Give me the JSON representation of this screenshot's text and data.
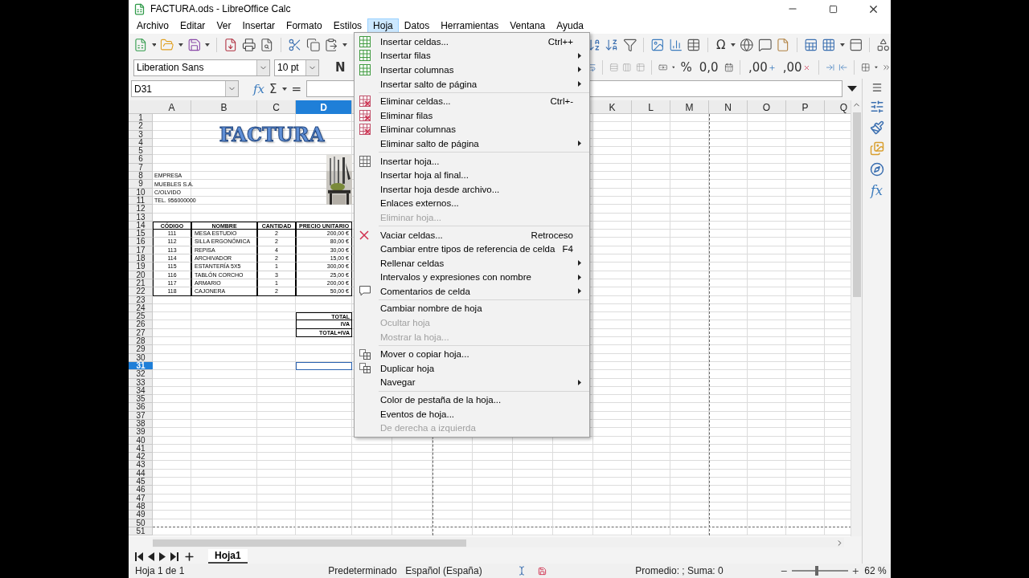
{
  "window": {
    "title": "FACTURA.ods - LibreOffice Calc"
  },
  "menubar": [
    {
      "label": "Archivo",
      "selected": false
    },
    {
      "label": "Editar",
      "selected": false
    },
    {
      "label": "Ver",
      "selected": false
    },
    {
      "label": "Insertar",
      "selected": false
    },
    {
      "label": "Formato",
      "selected": false
    },
    {
      "label": "Estilos",
      "selected": false
    },
    {
      "label": "Hoja",
      "selected": true
    },
    {
      "label": "Datos",
      "selected": false
    },
    {
      "label": "Herramientas",
      "selected": false
    },
    {
      "label": "Ventana",
      "selected": false
    },
    {
      "label": "Ayuda",
      "selected": false
    }
  ],
  "toolbar": {
    "special_character": "Ω",
    "percent": "%",
    "number_format": "0,0",
    "add_decimal": ",00",
    "delete_decimal": ",00",
    "bold": "N"
  },
  "font_name": "Liberation Sans",
  "font_size": "10 pt",
  "name_box": "D31",
  "formula_bar": {
    "function_wizard": "fx",
    "sum": "Σ",
    "equals": "="
  },
  "sheet": {
    "columns": [
      {
        "label": "A",
        "selected": false
      },
      {
        "label": "B",
        "selected": false
      },
      {
        "label": "C",
        "selected": false
      },
      {
        "label": "D",
        "selected": true
      },
      {
        "label": "K",
        "selected": false
      },
      {
        "label": "L",
        "selected": false
      },
      {
        "label": "M",
        "selected": false
      },
      {
        "label": "N",
        "selected": false
      },
      {
        "label": "O",
        "selected": false
      },
      {
        "label": "P",
        "selected": false
      },
      {
        "label": "Q",
        "selected": false
      }
    ],
    "rows": [
      {
        "label": "1",
        "selected": false
      },
      {
        "label": "2",
        "selected": false
      },
      {
        "label": "3",
        "selected": false
      },
      {
        "label": "4",
        "selected": false
      },
      {
        "label": "5",
        "selected": false
      },
      {
        "label": "6",
        "selected": false
      },
      {
        "label": "7",
        "selected": false
      },
      {
        "label": "8",
        "selected": false
      },
      {
        "label": "9",
        "selected": false
      },
      {
        "label": "10",
        "selected": false
      },
      {
        "label": "11",
        "selected": false
      },
      {
        "label": "12",
        "selected": false
      },
      {
        "label": "13",
        "selected": false
      },
      {
        "label": "14",
        "selected": false
      },
      {
        "label": "15",
        "selected": false
      },
      {
        "label": "16",
        "selected": false
      },
      {
        "label": "17",
        "selected": false
      },
      {
        "label": "18",
        "selected": false
      },
      {
        "label": "19",
        "selected": false
      },
      {
        "label": "20",
        "selected": false
      },
      {
        "label": "21",
        "selected": false
      },
      {
        "label": "22",
        "selected": false
      },
      {
        "label": "23",
        "selected": false
      },
      {
        "label": "24",
        "selected": false
      },
      {
        "label": "25",
        "selected": false
      },
      {
        "label": "26",
        "selected": false
      },
      {
        "label": "27",
        "selected": false
      },
      {
        "label": "28",
        "selected": false
      },
      {
        "label": "29",
        "selected": false
      },
      {
        "label": "30",
        "selected": false
      },
      {
        "label": "31",
        "selected": true
      },
      {
        "label": "32",
        "selected": false
      },
      {
        "label": "33",
        "selected": false
      },
      {
        "label": "34",
        "selected": false
      },
      {
        "label": "35",
        "selected": false
      },
      {
        "label": "36",
        "selected": false
      },
      {
        "label": "37",
        "selected": false
      },
      {
        "label": "38",
        "selected": false
      },
      {
        "label": "39",
        "selected": false
      },
      {
        "label": "40",
        "selected": false
      },
      {
        "label": "41",
        "selected": false
      },
      {
        "label": "42",
        "selected": false
      },
      {
        "label": "43",
        "selected": false
      },
      {
        "label": "44",
        "selected": false
      },
      {
        "label": "45",
        "selected": false
      },
      {
        "label": "46",
        "selected": false
      },
      {
        "label": "47",
        "selected": false
      },
      {
        "label": "48",
        "selected": false
      },
      {
        "label": "49",
        "selected": false
      },
      {
        "label": "50",
        "selected": false
      },
      {
        "label": "51",
        "selected": false
      }
    ],
    "title": "FACTURA",
    "picture": {
      "kind": "picture"
    },
    "company_lines": [
      "EMPRESA",
      "MUEBLES S.A.",
      "C/OLVIDO",
      "TEL. 956000000"
    ],
    "table": {
      "header": [
        "CÓDIGO",
        "NOMBRE",
        "CANTIDAD",
        "PRECIO UNITARIO"
      ],
      "rows": [
        [
          "111",
          "MESA ESTUDIO",
          "2",
          "200,00 €"
        ],
        [
          "112",
          "SILLA ERGONÓMICA",
          "2",
          "80,00 €"
        ],
        [
          "113",
          "REPISA",
          "4",
          "30,00 €"
        ],
        [
          "114",
          "ARCHIVADOR",
          "2",
          "15,00 €"
        ],
        [
          "115",
          "ESTANTERÍA 5X5",
          "1",
          "300,00 €"
        ],
        [
          "116",
          "TABLÓN CORCHO",
          "3",
          "25,00 €"
        ],
        [
          "117",
          "ARMARIO",
          "1",
          "200,00 €"
        ],
        [
          "118",
          "CAJONERA",
          "2",
          "50,00 €"
        ]
      ]
    },
    "totals": [
      "TOTAL",
      "IVA",
      "TOTAL+IVA"
    ]
  },
  "sheet_menu": {
    "groups": [
      [
        {
          "kind": "insert",
          "label": "Insertar celdas...",
          "shortcut": "Ctrl++",
          "submenu": false,
          "disabled": false
        },
        {
          "kind": "insert",
          "label": "Insertar filas",
          "submenu": true,
          "disabled": false
        },
        {
          "kind": "insert",
          "label": "Insertar columnas",
          "submenu": true,
          "disabled": false
        },
        {
          "kind": "plain",
          "label": "Insertar salto de página",
          "submenu": true,
          "disabled": false
        }
      ],
      [
        {
          "kind": "delete",
          "label": "Eliminar celdas...",
          "shortcut": "Ctrl+-",
          "submenu": false,
          "disabled": false
        },
        {
          "kind": "delete",
          "label": "Eliminar filas",
          "submenu": false,
          "disabled": false
        },
        {
          "kind": "delete",
          "label": "Eliminar columnas",
          "submenu": false,
          "disabled": false
        },
        {
          "kind": "plain",
          "label": "Eliminar salto de página",
          "submenu": true,
          "disabled": false
        }
      ],
      [
        {
          "kind": "sheet",
          "label": "Insertar hoja...",
          "submenu": false,
          "disabled": false
        },
        {
          "kind": "plain",
          "label": "Insertar hoja al final...",
          "submenu": false,
          "disabled": false
        },
        {
          "kind": "plain",
          "label": "Insertar hoja desde archivo...",
          "submenu": false,
          "disabled": false
        },
        {
          "kind": "plain",
          "label": "Enlaces externos...",
          "submenu": false,
          "disabled": false
        },
        {
          "kind": "plain",
          "label": "Eliminar hoja...",
          "submenu": false,
          "disabled": true
        }
      ],
      [
        {
          "kind": "clear",
          "label": "Vaciar celdas...",
          "shortcut": "Retroceso",
          "submenu": false,
          "disabled": false
        },
        {
          "kind": "plain",
          "label": "Cambiar entre tipos de referencia de celda",
          "shortcut": "F4",
          "submenu": false,
          "disabled": false
        },
        {
          "kind": "plain",
          "label": "Rellenar celdas",
          "submenu": true,
          "disabled": false
        },
        {
          "kind": "plain",
          "label": "Intervalos y expresiones con nombre",
          "submenu": true,
          "disabled": false
        },
        {
          "kind": "comment",
          "label": "Comentarios de celda",
          "submenu": true,
          "disabled": false
        }
      ],
      [
        {
          "kind": "plain",
          "label": "Cambiar nombre de hoja",
          "submenu": false,
          "disabled": false
        },
        {
          "kind": "plain",
          "label": "Ocultar hoja",
          "submenu": false,
          "disabled": true
        },
        {
          "kind": "plain",
          "label": "Mostrar la hoja...",
          "submenu": false,
          "disabled": true
        }
      ],
      [
        {
          "kind": "move",
          "label": "Mover o copiar hoja...",
          "submenu": false,
          "disabled": false
        },
        {
          "kind": "move",
          "label": "Duplicar hoja",
          "submenu": false,
          "disabled": false
        },
        {
          "kind": "plain",
          "label": "Navegar",
          "submenu": true,
          "disabled": false
        }
      ],
      [
        {
          "kind": "plain",
          "label": "Color de pestaña de la hoja...",
          "submenu": false,
          "disabled": false
        },
        {
          "kind": "plain",
          "label": "Eventos de hoja...",
          "submenu": false,
          "disabled": false
        },
        {
          "kind": "plain",
          "label": "De derecha a izquierda",
          "submenu": false,
          "disabled": true
        }
      ]
    ]
  },
  "sheet_tabs": [
    {
      "label": "Hoja1",
      "selected": true
    }
  ],
  "sidebar": {
    "functions": "fx"
  },
  "status_bar": {
    "sheet": "Hoja 1 de 1",
    "page_style": "Predeterminado",
    "language": "Español (España)",
    "summary": "Promedio: ; Suma: 0",
    "zoom": {
      "level": 0.45,
      "reading": "62 %"
    }
  }
}
